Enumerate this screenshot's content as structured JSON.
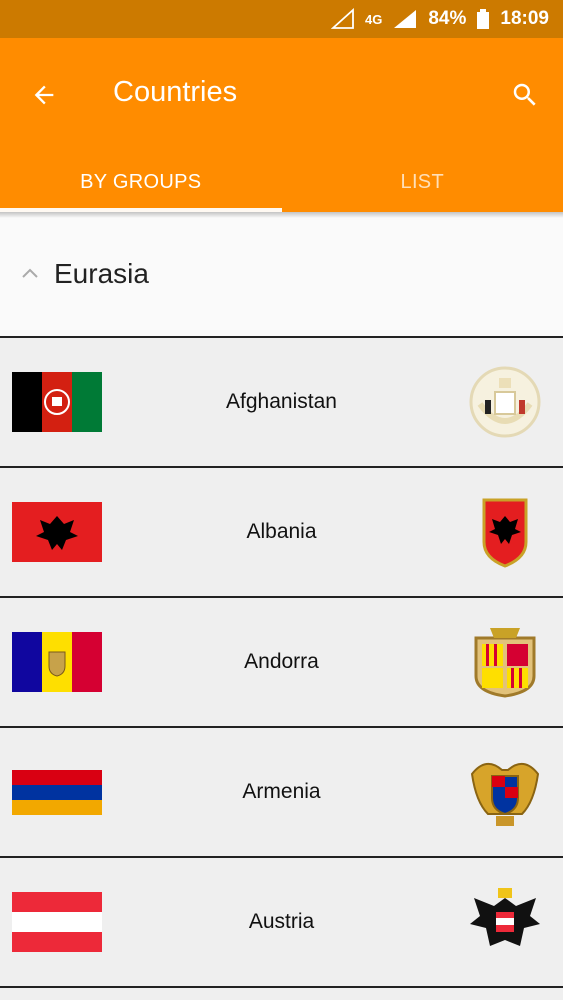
{
  "status_bar": {
    "battery": "84%",
    "time": "18:09",
    "network": "4G"
  },
  "toolbar": {
    "title": "Countries"
  },
  "tabs": [
    {
      "label": "BY GROUPS",
      "active": true
    },
    {
      "label": "LIST",
      "active": false
    }
  ],
  "group": {
    "title": "Eurasia"
  },
  "countries": [
    {
      "name": "Afghanistan"
    },
    {
      "name": "Albania"
    },
    {
      "name": "Andorra"
    },
    {
      "name": "Armenia"
    },
    {
      "name": "Austria"
    }
  ],
  "colors": {
    "status_bar": "#cc7a00",
    "app_bar": "#ff8c00",
    "background": "#efefef"
  }
}
